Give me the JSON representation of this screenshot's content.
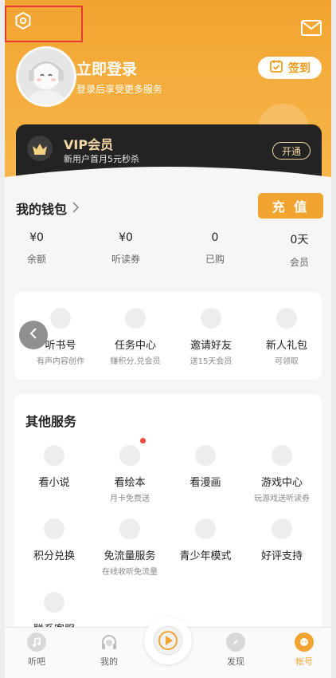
{
  "header": {
    "login_title": "立即登录",
    "login_subtitle": "登录后享受更多服务",
    "signin_label": "签到",
    "settings_icon": "settings-hexagon-icon",
    "mail_icon": "mail-icon"
  },
  "vip": {
    "title": "VIP会员",
    "subtitle": "新用户首月5元秒杀",
    "button": "开通"
  },
  "wallet": {
    "title": "我的钱包",
    "recharge": "充 值",
    "stats": [
      {
        "value": "¥0",
        "label": "余额"
      },
      {
        "value": "¥0",
        "label": "听读券"
      },
      {
        "value": "0",
        "label": "已购"
      },
      {
        "value": "0天",
        "label": "会员"
      }
    ]
  },
  "features": [
    {
      "title": "听书号",
      "sub": "有声内容创作"
    },
    {
      "title": "任务中心",
      "sub": "赚积分,兑会员"
    },
    {
      "title": "邀请好友",
      "sub": "送15天会员"
    },
    {
      "title": "新人礼包",
      "sub": "可领取"
    }
  ],
  "other_services": {
    "title": "其他服务",
    "items": [
      {
        "title": "看小说",
        "sub": ""
      },
      {
        "title": "看绘本",
        "sub": "月卡免费送"
      },
      {
        "title": "看漫画",
        "sub": ""
      },
      {
        "title": "游戏中心",
        "sub": "玩游戏送听读券"
      },
      {
        "title": "积分兑换",
        "sub": ""
      },
      {
        "title": "免流量服务",
        "sub": "在线收听免流量"
      },
      {
        "title": "青少年模式",
        "sub": ""
      },
      {
        "title": "好评支持",
        "sub": ""
      },
      {
        "title": "联系客服",
        "sub": ""
      }
    ]
  },
  "bottom_nav": [
    {
      "label": "听吧"
    },
    {
      "label": "我的"
    },
    {
      "label": "发现"
    },
    {
      "label": "帐号"
    }
  ],
  "colors": {
    "accent": "#f2a431",
    "vip_gold": "#f5d9a4",
    "badge_red": "#ef4a3a"
  }
}
